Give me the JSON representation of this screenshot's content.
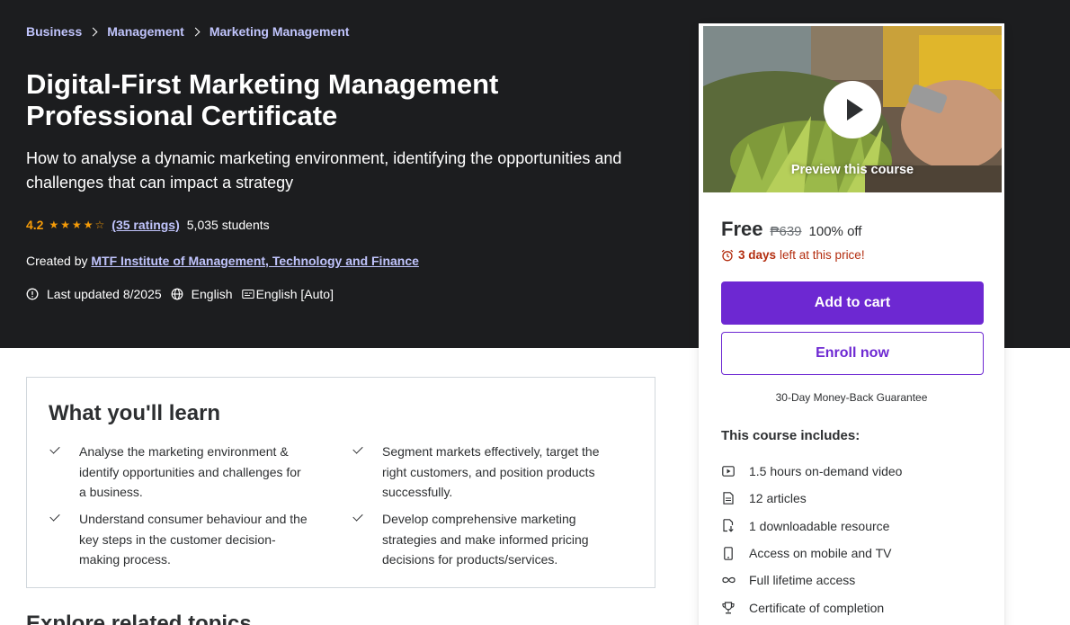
{
  "breadcrumb": [
    "Business",
    "Management",
    "Marketing Management"
  ],
  "course": {
    "title": "Digital-First Marketing Management Professional Certificate",
    "subtitle": "How to analyse a dynamic marketing environment, identifying the opportunities and challenges that can impact a strategy",
    "rating": "4.2",
    "rating_value": 4.2,
    "ratings_count": "(35 ratings)",
    "students": "5,035 students",
    "created_by_label": "Created by",
    "author": "MTF Institute of Management, Technology and Finance",
    "last_updated": "Last updated 8/2025",
    "language": "English",
    "captions": "English [Auto]"
  },
  "learn": {
    "title": "What you'll learn",
    "items": [
      "Analyse the marketing environment & identify opportunities and challenges for a business.",
      "Segment markets effectively, target the right customers, and position products successfully.",
      "Understand consumer behaviour and the key steps in the customer decision-making process.",
      "Develop comprehensive marketing strategies and make informed pricing decisions for products/services."
    ]
  },
  "next_section_title": "Explore related topics",
  "sidebar": {
    "preview_label": "Preview this course",
    "price": "Free",
    "original_price": "₱639",
    "discount": "100% off",
    "timer_days": "3 days",
    "timer_rest": "left at this price!",
    "add_to_cart": "Add to cart",
    "enroll_now": "Enroll now",
    "guarantee": "30-Day Money-Back Guarantee",
    "includes_title": "This course includes:",
    "includes": [
      {
        "icon": "video-icon",
        "label": "1.5 hours on-demand video"
      },
      {
        "icon": "article-icon",
        "label": "12 articles"
      },
      {
        "icon": "download-icon",
        "label": "1 downloadable resource"
      },
      {
        "icon": "mobile-icon",
        "label": "Access on mobile and TV"
      },
      {
        "icon": "infinity-icon",
        "label": "Full lifetime access"
      },
      {
        "icon": "trophy-icon",
        "label": "Certificate of completion"
      }
    ]
  },
  "colors": {
    "hero_bg": "#1c1d1f",
    "link_purple": "#c0c4fc",
    "star_orange": "#f69c08",
    "brand_purple": "#6d28d2",
    "timer_red": "#b32d0f"
  }
}
